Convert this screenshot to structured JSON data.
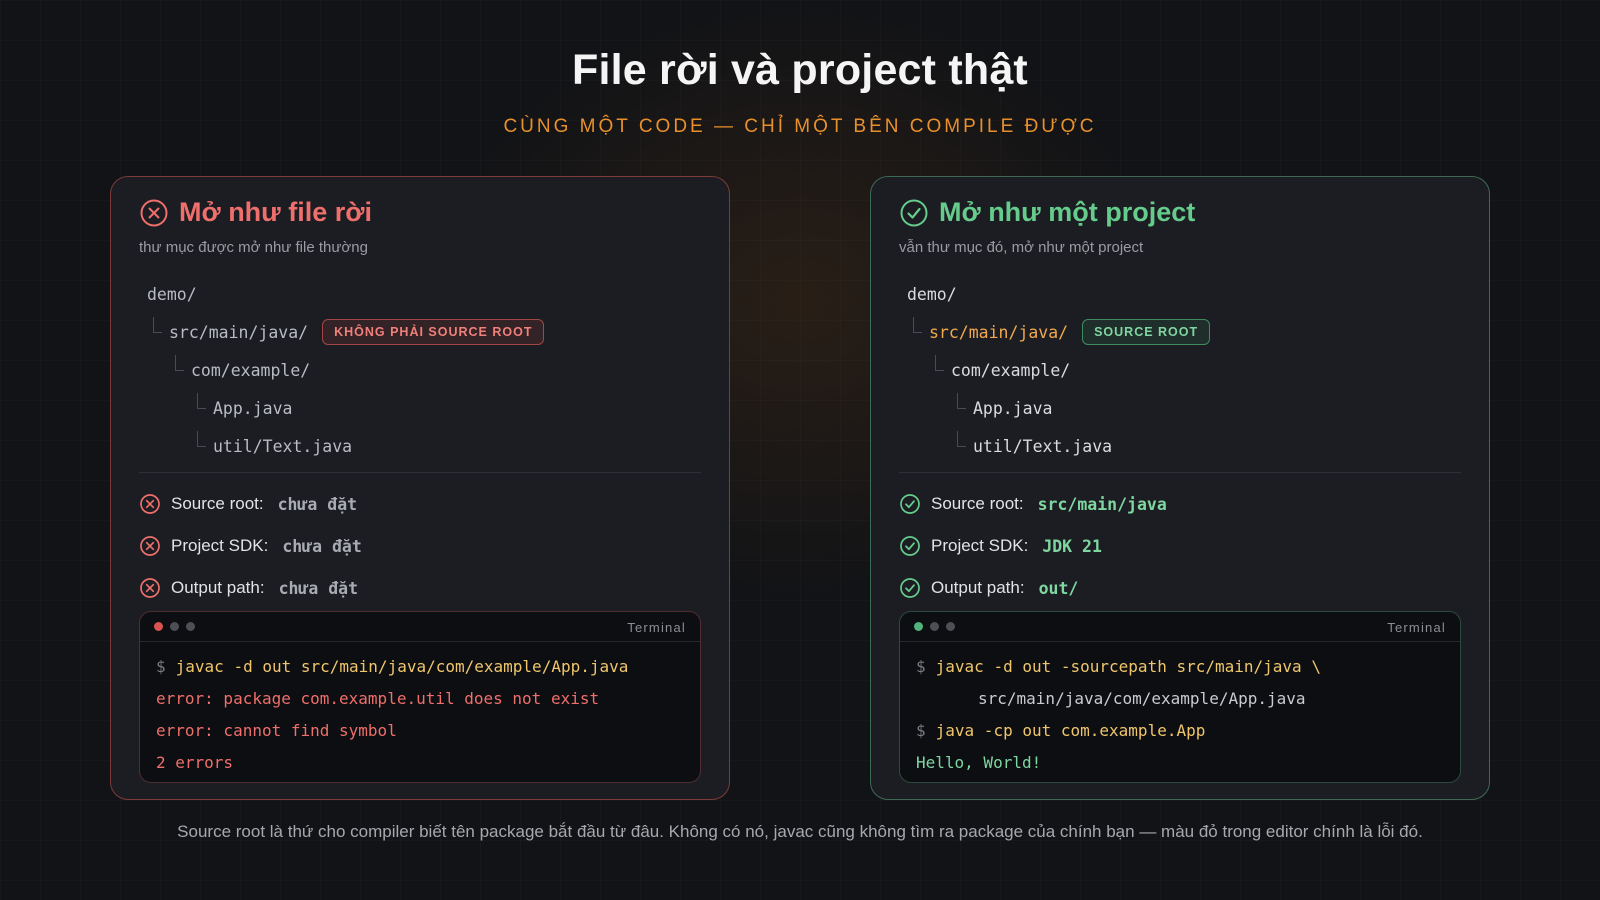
{
  "header": {
    "title": "File rời và project thật",
    "subtitle": "CÙNG MỘT CODE — CHỈ MỘT BÊN COMPILE ĐƯỢC"
  },
  "colors": {
    "accent_orange": "#e8902c",
    "bad_red": "#ee6f6b",
    "good_green": "#66cc8c",
    "command_yellow": "#f0c66b"
  },
  "left": {
    "title": "Mở như file rời",
    "subtitle": "thư mục được mở như file thường",
    "tree": [
      "demo/",
      "src/main/java/",
      "com/example/",
      "App.java",
      "util/Text.java"
    ],
    "badge": "KHÔNG PHẢI SOURCE ROOT",
    "props": [
      {
        "label": "Source root:",
        "value": "chưa đặt"
      },
      {
        "label": "Project SDK:",
        "value": "chưa đặt"
      },
      {
        "label": "Output path:",
        "value": "chưa đặt"
      }
    ],
    "terminal_label": "Terminal",
    "prompt": "$",
    "terminal": [
      "javac -d out src/main/java/com/example/App.java",
      "error: package com.example.util does not exist",
      "error: cannot find symbol",
      "2 errors"
    ]
  },
  "right": {
    "title": "Mở như một project",
    "subtitle": "vẫn thư mục đó, mở như một project",
    "tree": [
      "demo/",
      "src/main/java/",
      "com/example/",
      "App.java",
      "util/Text.java"
    ],
    "badge": "SOURCE ROOT",
    "props": [
      {
        "label": "Source root:",
        "value": "src/main/java"
      },
      {
        "label": "Project SDK:",
        "value": "JDK 21"
      },
      {
        "label": "Output path:",
        "value": "out/"
      }
    ],
    "terminal_label": "Terminal",
    "prompt": "$",
    "terminal": [
      "javac -d out -sourcepath src/main/java \\",
      "src/main/java/com/example/App.java",
      "java -cp out com.example.App",
      "Hello, World!"
    ]
  },
  "footer": "Source root là thứ cho compiler biết tên package bắt đầu từ đâu. Không có nó, javac cũng không tìm ra package của chính bạn — màu đỏ trong editor chính là lỗi đó."
}
